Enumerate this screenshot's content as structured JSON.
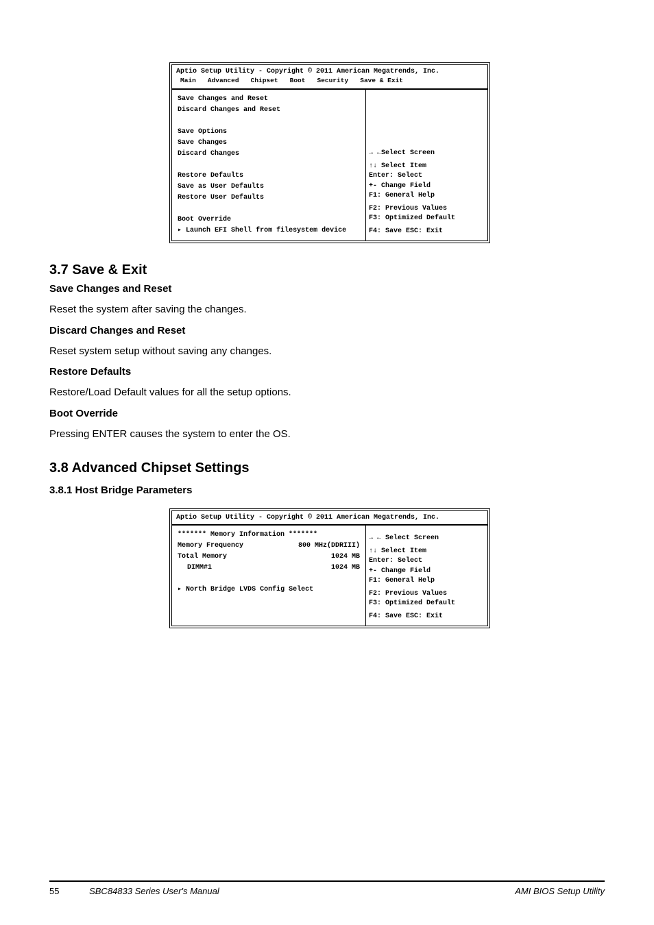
{
  "box1": {
    "header_title": "Aptio Setup Utility - Copyright © 2011 American Megatrends, Inc.",
    "tabs_line1": "Main   Advanced   Chipset   Boot   Security   Save & Exit",
    "left": {
      "r1a": "Save Changes and Reset",
      "r2a": "Discard Changes and Reset",
      "gap1": "",
      "r3a": "Save Options",
      "r4a": "Save Changes",
      "r5a": "Discard Changes",
      "gap2": "",
      "r6a": "Restore Defaults",
      "r7a": "Save as User Defaults",
      "r8a": "Restore User Defaults",
      "gap3": "",
      "r9a": "Boot Override",
      "r10a": "Launch EFI Shell from filesystem device",
      "r10pre": "▸"
    },
    "right_help_blank": "",
    "right_keys": [
      "→ ←Select Screen",
      "↑↓ Select Item",
      "Enter: Select",
      "+-  Change Field",
      "F1: General Help",
      "F2: Previous Values",
      "F3: Optimized Default",
      "F4: Save  ESC: Exit"
    ]
  },
  "section1": {
    "title": "3.7 Save & Exit",
    "p1": "Save Changes and Reset",
    "p2": "Reset the system after saving the changes.",
    "p3": "Discard Changes and Reset",
    "p4": "Reset system setup without saving any changes.",
    "p5": "Restore Defaults",
    "p6": "Restore/Load Default values for all the setup options.",
    "p7": "Boot Override",
    "p8": "Pressing ENTER causes the system to enter the OS."
  },
  "section2": {
    "title": "3.8 Advanced Chipset Settings",
    "sub1": "3.8.1 Host Bridge Parameters"
  },
  "box2": {
    "header_title": "Aptio Setup Utility - Copyright © 2011 American Megatrends, Inc.",
    "left": {
      "r1a": "******* Memory Information *******",
      "r2a": "Memory Frequency",
      "r2b": "800 MHz(DDRIII)",
      "r3a": "Total Memory",
      "r3b": "1024 MB",
      "r4a": " DIMM#1",
      "r4b": "1024 MB",
      "gap1": "",
      "r5a": "North Bridge LVDS Config Select",
      "r5pre": "▸"
    },
    "right_help_blank": "",
    "right_keys": [
      "→ ← Select Screen",
      "↑↓  Select Item",
      "Enter: Select",
      "+-   Change Field",
      "F1:  General Help",
      "F2:  Previous Values",
      "F3: Optimized Default",
      "F4: Save  ESC: Exit"
    ]
  },
  "footer": {
    "left": "SBC84833 Series User's Manual",
    "right": "AMI BIOS Setup Utility",
    "page": "55"
  }
}
